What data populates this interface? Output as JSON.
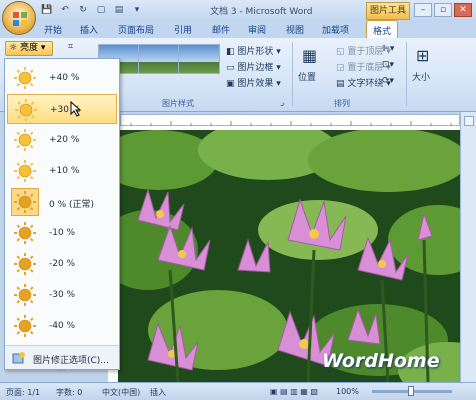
{
  "window": {
    "title": "文档 3 - Microsoft Word",
    "contextual_tab": "图片工具"
  },
  "tabs": [
    {
      "label": "开始"
    },
    {
      "label": "插入"
    },
    {
      "label": "页面布局"
    },
    {
      "label": "引用"
    },
    {
      "label": "邮件"
    },
    {
      "label": "审阅"
    },
    {
      "label": "视图"
    },
    {
      "label": "加载项"
    },
    {
      "label": "格式",
      "active": true
    }
  ],
  "ribbon": {
    "brightness_label": "亮度",
    "picture_styles": {
      "group_label": "图片样式",
      "shape": "图片形状",
      "border": "图片边框",
      "effects": "图片效果"
    },
    "arrange": {
      "group_label": "排列",
      "position": "位置",
      "bring_front": "置于顶层",
      "send_back": "置于底层",
      "text_wrap": "文字环绕"
    },
    "size": {
      "label": "大小"
    }
  },
  "brightness_menu": {
    "items": [
      {
        "label": "+40 %"
      },
      {
        "label": "+30 %",
        "hover": true
      },
      {
        "label": "+20 %"
      },
      {
        "label": "+10 %"
      },
      {
        "label": "0 % (正常)",
        "current": true
      },
      {
        "label": "-10 %"
      },
      {
        "label": "-20 %"
      },
      {
        "label": "-30 %"
      },
      {
        "label": "-40 %"
      }
    ],
    "footer": "图片修正选项(C)..."
  },
  "statusbar": {
    "page": "页面: 1/1",
    "words": "字数: 0",
    "language": "中文(中国)",
    "insert": "插入",
    "zoom": "100%"
  },
  "watermark": "WordHome",
  "colors": {
    "ribbon_bg": "#d3e3f6",
    "hover_item": "#fddc82",
    "contextual_tab": "#f0bd52"
  }
}
